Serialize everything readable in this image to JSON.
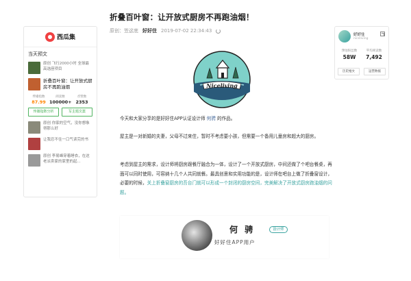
{
  "left_sidebar": {
    "logo": "西瓜集",
    "section_title": "当天预文",
    "items": [
      {
        "text": "原创 飞行2000小时 全球最高选座项目",
        "thumb": "#4a6b3a"
      },
      {
        "text": "折叠百叶窗：让开放式厨房不再跑油烟",
        "thumb": "#c06030"
      },
      {
        "text": "原创 你家的空气，没你想象得那么好",
        "thumb": "#8a8a7a"
      },
      {
        "text": "让我忍不住一口气读完的书",
        "thumb": "#b04040"
      },
      {
        "text": "原创 李易峰穿着睡衣，在这老派卖家的家里的起...",
        "thumb": "#9a9a9a"
      }
    ],
    "stats": [
      {
        "label": "传播指数",
        "value": "87.99"
      },
      {
        "label": "阅读数",
        "value": "100000+"
      },
      {
        "label": "点赞数",
        "value": "2353"
      }
    ],
    "buttons": {
      "analysis": "传播指数分析",
      "copy": "写主题文案"
    }
  },
  "article": {
    "title": "折叠百叶窗：让开放式厨房不再跑油烟！",
    "meta": {
      "original": "原创：",
      "org": "笠这底",
      "author": "好好住",
      "datetime": "2019-07-02 22:34:43"
    },
    "hero_logo_text": "Niceliving",
    "p1_before": "今天和大家分享的是好好住APP认证设计师 ",
    "p1_link": "何骋",
    "p1_after": " 的作品。",
    "p2": "屋主是一对新婚的夫妻，父母不过来住，暂时不考虑要小孩，但需要一个备用儿童房和超大的厨房。",
    "p3_normal": "考虑到屋主的需求，设计师将厨房跟餐厅融合为一体，设计了一个开放式厨房，中间还做了个吧台餐桌，再面可以同时使用，可容纳十几个人共同就餐。最具创意和实用功能的是，设计师在吧台上做了折叠窗设计，必要的时候，",
    "p3_highlight": "关上折叠窗厨房的吾台门就可以形成一个封闭的厨房空间，完美解决了开放式厨房跑油烟的问题。",
    "author_card": {
      "name": "何 骋",
      "badge": "设计师",
      "subtitle": "好好住APP用户"
    }
  },
  "right_sidebar": {
    "name": "好好住",
    "sub": "niceliving",
    "stats": [
      {
        "label": "预估粉丝数",
        "value": "58W"
      },
      {
        "label": "平均阅读数",
        "value": "7,492"
      }
    ],
    "buttons": {
      "history": "历史推文",
      "data": "运营数据"
    }
  }
}
